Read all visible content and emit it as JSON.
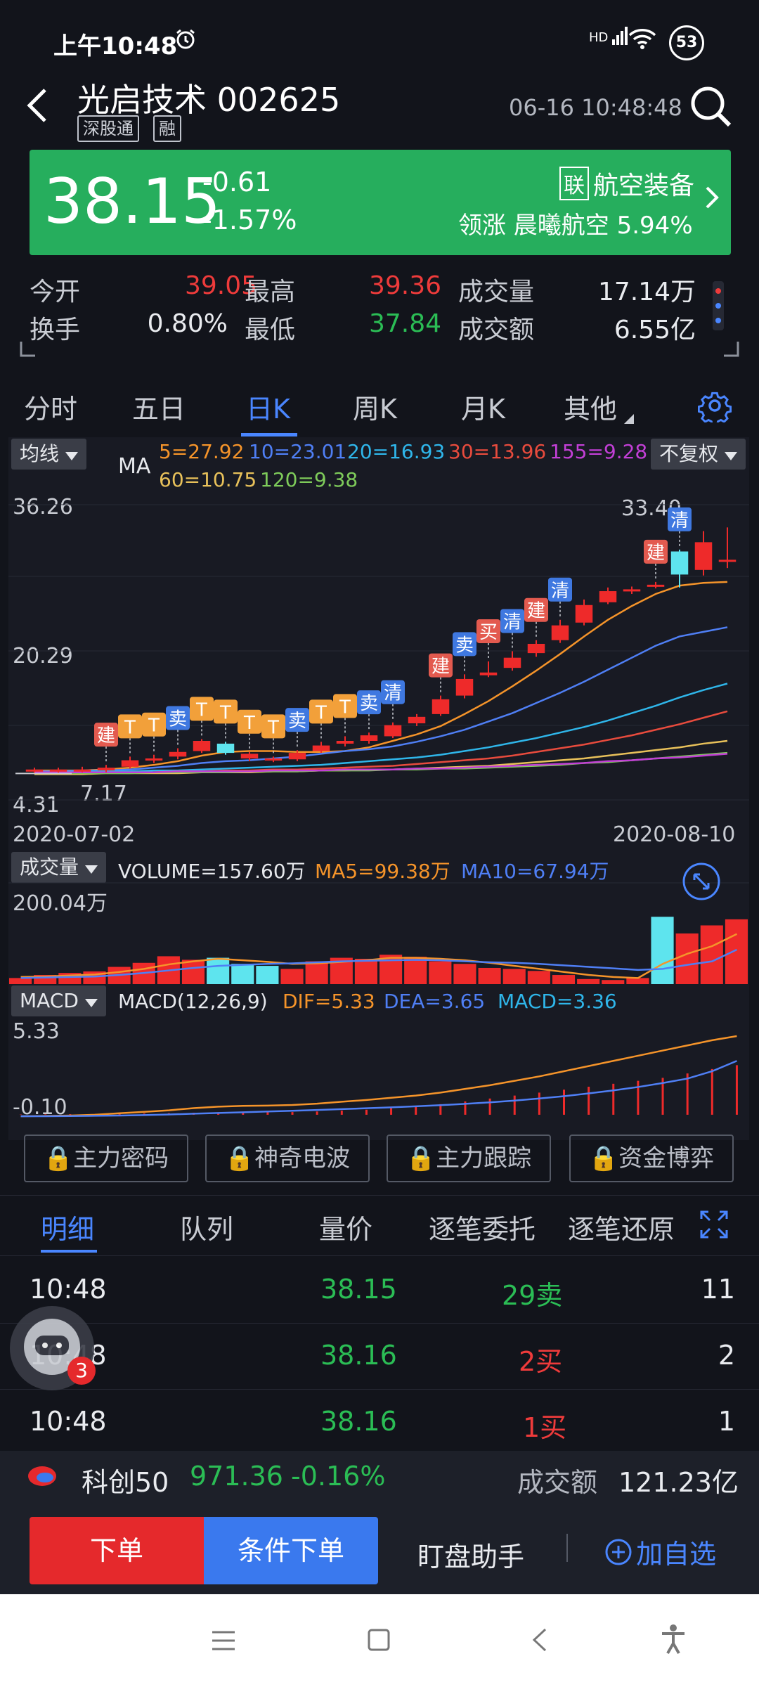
{
  "status": {
    "time": "上午10:48",
    "signal_label": "HD",
    "battery": "53"
  },
  "header": {
    "title": "光启技术 002625",
    "badges": [
      "深股通",
      "融"
    ],
    "datetime": "06-16 10:48:48"
  },
  "banner": {
    "price": "38.15",
    "change": "-0.61",
    "change_pct": "-1.57%",
    "lian_tag": "联",
    "sector": "航空装备",
    "lead": "领涨 晨曦航空 5.94%"
  },
  "quote": {
    "open_label": "今开",
    "open": "39.05",
    "high_label": "最高",
    "high": "39.36",
    "vol_label": "成交量",
    "vol": "17.14万",
    "turnover_label": "换手",
    "turnover": "0.80%",
    "low_label": "最低",
    "low": "37.84",
    "amount_label": "成交额",
    "amount": "6.55亿"
  },
  "period_tabs": [
    "分时",
    "五日",
    "日K",
    "周K",
    "月K",
    "其他"
  ],
  "ma_panel": {
    "selector": "均线",
    "ma_label": "MA",
    "ma5": "5=27.92",
    "ma10": "10=23.01",
    "ma20": "20=16.93",
    "ma30": "30=13.96",
    "ma155": "155=9.28",
    "ma60": "60=10.75",
    "ma120": "120=9.38",
    "adjust": "不复权",
    "y_top": "36.26",
    "y_mid": "20.29",
    "y_low": "4.31",
    "hi_marker": "33.40",
    "lo_marker": "7.17",
    "date_start": "2020-07-02",
    "date_end": "2020-08-10",
    "colors": {
      "ma5": "#f5942a",
      "ma10": "#4f7ff5",
      "ma20": "#2fb6ea",
      "ma30": "#e84b3d",
      "ma155": "#c23fd6",
      "ma60": "#e8c15a",
      "ma120": "#7ecb5a"
    }
  },
  "vol_panel": {
    "selector": "成交量",
    "volume": "VOLUME=157.60万",
    "ma5": "MA5=99.38万",
    "ma10": "MA10=67.94万",
    "y_top": "200.04万"
  },
  "macd_panel": {
    "selector": "MACD",
    "params": "MACD(12,26,9)",
    "dif": "DIF=5.33",
    "dea": "DEA=3.65",
    "macd": "MACD=3.36",
    "y_top": "5.33",
    "y_low": "-0.10"
  },
  "locked": [
    "主力密码",
    "神奇电波",
    "主力跟踪",
    "资金博弈"
  ],
  "detail_tabs": [
    "明细",
    "队列",
    "量价",
    "逐笔委托",
    "逐笔还原"
  ],
  "trades": [
    {
      "time": "10:48",
      "price": "38.15",
      "side": "29卖",
      "count": "11",
      "side_color": "#2bbd55"
    },
    {
      "time": "10:48",
      "price": "38.16",
      "side": "2买",
      "count": "2",
      "side_color": "#ee3b3b"
    },
    {
      "time": "10:48",
      "price": "38.16",
      "side": "1买",
      "count": "1",
      "side_color": "#ee3b3b"
    }
  ],
  "avatar_badge": "3",
  "index": {
    "name": "科创50",
    "value": "971.36",
    "pct": "-0.16%",
    "amount_label": "成交额",
    "amount": "121.23亿"
  },
  "actions": {
    "order": "下单",
    "cond_order": "条件下单",
    "assistant": "盯盘助手",
    "add_watch": "加自选"
  },
  "chart_data": {
    "type": "candlestick",
    "x_range": [
      "2020-07-02",
      "2020-08-10"
    ],
    "y_range": [
      4.31,
      36.26
    ],
    "high_marker": 33.4,
    "low_marker": 7.17,
    "candles": [
      {
        "o": 7.6,
        "c": 7.4,
        "h": 7.8,
        "l": 7.2
      },
      {
        "o": 7.4,
        "c": 7.6,
        "h": 7.8,
        "l": 7.2
      },
      {
        "o": 7.6,
        "c": 7.5,
        "h": 7.9,
        "l": 7.3
      },
      {
        "o": 7.5,
        "c": 7.8,
        "h": 8.1,
        "l": 7.3
      },
      {
        "o": 7.9,
        "c": 8.6,
        "h": 9.0,
        "l": 7.7
      },
      {
        "o": 8.7,
        "c": 8.8,
        "h": 9.2,
        "l": 8.3
      },
      {
        "o": 9.0,
        "c": 9.5,
        "h": 9.9,
        "l": 8.7
      },
      {
        "o": 9.6,
        "c": 10.7,
        "h": 10.9,
        "l": 9.4
      },
      {
        "o": 10.4,
        "c": 9.4,
        "h": 10.6,
        "l": 9.2
      },
      {
        "o": 9.3,
        "c": 8.8,
        "h": 9.5,
        "l": 8.5
      },
      {
        "o": 8.8,
        "c": 8.6,
        "h": 9.0,
        "l": 8.4
      },
      {
        "o": 8.7,
        "c": 9.4,
        "h": 9.7,
        "l": 8.5
      },
      {
        "o": 9.6,
        "c": 10.2,
        "h": 10.6,
        "l": 9.4
      },
      {
        "o": 10.4,
        "c": 10.7,
        "h": 11.2,
        "l": 10.1
      },
      {
        "o": 10.7,
        "c": 11.3,
        "h": 11.6,
        "l": 10.4
      },
      {
        "o": 11.2,
        "c": 12.4,
        "h": 12.7,
        "l": 11.0
      },
      {
        "o": 12.6,
        "c": 13.3,
        "h": 13.6,
        "l": 12.3
      },
      {
        "o": 13.6,
        "c": 15.2,
        "h": 15.6,
        "l": 13.4
      },
      {
        "o": 15.6,
        "c": 17.4,
        "h": 17.9,
        "l": 15.3
      },
      {
        "o": 17.8,
        "c": 18.1,
        "h": 19.3,
        "l": 17.6
      },
      {
        "o": 18.6,
        "c": 19.7,
        "h": 20.4,
        "l": 18.3
      },
      {
        "o": 20.2,
        "c": 21.2,
        "h": 21.6,
        "l": 19.8
      },
      {
        "o": 21.6,
        "c": 23.2,
        "h": 23.8,
        "l": 21.3
      },
      {
        "o": 23.5,
        "c": 25.4,
        "h": 26.0,
        "l": 23.2
      },
      {
        "o": 25.7,
        "c": 26.9,
        "h": 27.3,
        "l": 25.5
      },
      {
        "o": 27.0,
        "c": 27.1,
        "h": 27.4,
        "l": 26.6
      },
      {
        "o": 27.5,
        "c": 27.6,
        "h": 27.9,
        "l": 27.2
      },
      {
        "o": 28.7,
        "c": 31.2,
        "h": 31.4,
        "l": 27.3
      },
      {
        "o": 32.2,
        "c": 29.2,
        "h": 33.4,
        "l": 28.6
      },
      {
        "o": 30.1,
        "c": 30.3,
        "h": 33.8,
        "l": 29.4
      }
    ],
    "ma": {
      "MA5": [
        7.5,
        7.5,
        7.5,
        7.6,
        7.8,
        8.1,
        8.5,
        9.1,
        9.5,
        9.6,
        9.6,
        9.5,
        9.5,
        9.6,
        10.0,
        10.7,
        11.4,
        12.3,
        13.6,
        15.0,
        16.6,
        18.3,
        20.1,
        22.0,
        23.8,
        25.3,
        26.6,
        27.5,
        27.8,
        27.9
      ],
      "MA10": [
        7.4,
        7.4,
        7.5,
        7.5,
        7.6,
        7.8,
        8.0,
        8.3,
        8.5,
        8.6,
        8.8,
        9.0,
        9.3,
        9.6,
        9.8,
        10.1,
        10.6,
        11.2,
        11.9,
        12.8,
        13.7,
        14.8,
        15.9,
        17.1,
        18.4,
        19.7,
        21.0,
        22.0,
        22.5,
        23.0
      ],
      "MA20": [
        7.3,
        7.3,
        7.4,
        7.4,
        7.4,
        7.5,
        7.5,
        7.6,
        7.7,
        7.8,
        7.9,
        8.0,
        8.1,
        8.3,
        8.5,
        8.7,
        8.9,
        9.2,
        9.6,
        10.0,
        10.5,
        11.0,
        11.6,
        12.2,
        12.9,
        13.7,
        14.5,
        15.4,
        16.2,
        16.9
      ],
      "MA30": [
        7.2,
        7.2,
        7.3,
        7.3,
        7.3,
        7.3,
        7.4,
        7.4,
        7.5,
        7.5,
        7.6,
        7.6,
        7.7,
        7.8,
        7.9,
        8.0,
        8.2,
        8.4,
        8.6,
        8.8,
        9.1,
        9.5,
        9.9,
        10.3,
        10.8,
        11.3,
        11.9,
        12.5,
        13.2,
        13.9
      ],
      "MA60": [
        7.1,
        7.1,
        7.1,
        7.2,
        7.2,
        7.2,
        7.2,
        7.3,
        7.3,
        7.3,
        7.4,
        7.4,
        7.5,
        7.5,
        7.6,
        7.6,
        7.7,
        7.8,
        7.9,
        8.0,
        8.2,
        8.4,
        8.6,
        8.8,
        9.1,
        9.4,
        9.7,
        10.0,
        10.4,
        10.7
      ],
      "MA120": [
        7.2,
        7.2,
        7.2,
        7.2,
        7.2,
        7.3,
        7.3,
        7.3,
        7.3,
        7.4,
        7.4,
        7.4,
        7.5,
        7.5,
        7.5,
        7.6,
        7.6,
        7.7,
        7.7,
        7.8,
        7.9,
        8.0,
        8.1,
        8.3,
        8.4,
        8.6,
        8.8,
        9.0,
        9.2,
        9.4
      ],
      "MA155": [
        7.3,
        7.3,
        7.3,
        7.3,
        7.3,
        7.3,
        7.4,
        7.4,
        7.4,
        7.4,
        7.5,
        7.5,
        7.5,
        7.6,
        7.6,
        7.6,
        7.7,
        7.7,
        7.8,
        7.9,
        8.0,
        8.1,
        8.2,
        8.3,
        8.5,
        8.6,
        8.8,
        8.9,
        9.1,
        9.3
      ]
    },
    "signals": [
      {
        "i": 3,
        "t": "建"
      },
      {
        "i": 4,
        "t": "T"
      },
      {
        "i": 5,
        "t": "T"
      },
      {
        "i": 6,
        "t": "卖"
      },
      {
        "i": 7,
        "t": "T"
      },
      {
        "i": 8,
        "t": "T"
      },
      {
        "i": 9,
        "t": "T"
      },
      {
        "i": 10,
        "t": "T"
      },
      {
        "i": 11,
        "t": "卖"
      },
      {
        "i": 12,
        "t": "T"
      },
      {
        "i": 13,
        "t": "T"
      },
      {
        "i": 14,
        "t": "卖"
      },
      {
        "i": 15,
        "t": "清"
      },
      {
        "i": 17,
        "t": "建"
      },
      {
        "i": 18,
        "t": "卖"
      },
      {
        "i": 19,
        "t": "买"
      },
      {
        "i": 20,
        "t": "清"
      },
      {
        "i": 21,
        "t": "建"
      },
      {
        "i": 22,
        "t": "清"
      },
      {
        "i": 26,
        "t": "建"
      },
      {
        "i": 27,
        "t": "清"
      }
    ],
    "volume_wan": [
      12,
      18,
      22,
      25,
      34,
      42,
      55,
      48,
      52,
      40,
      36,
      30,
      45,
      52,
      50,
      58,
      54,
      45,
      40,
      32,
      30,
      26,
      18,
      10,
      8,
      12,
      133,
      100,
      116,
      128
    ],
    "volume_up": [
      true,
      true,
      true,
      true,
      true,
      true,
      true,
      true,
      false,
      false,
      false,
      true,
      true,
      true,
      true,
      true,
      true,
      true,
      true,
      true,
      true,
      true,
      true,
      true,
      true,
      true,
      false,
      true,
      true,
      true
    ],
    "vol_ma5": [
      14,
      15,
      17,
      19,
      24,
      30,
      39,
      45,
      50,
      47,
      44,
      40,
      41,
      44,
      47,
      52,
      52,
      50,
      47,
      42,
      36,
      30,
      24,
      18,
      14,
      12,
      40,
      60,
      75,
      99
    ],
    "vol_ma10": [
      12,
      13,
      14,
      15,
      18,
      22,
      27,
      32,
      36,
      38,
      40,
      41,
      43,
      45,
      46,
      47,
      48,
      47,
      45,
      43,
      42,
      40,
      37,
      34,
      31,
      28,
      30,
      38,
      45,
      68
    ],
    "macd_bar": [
      0.02,
      0.03,
      0.04,
      0.05,
      0.07,
      0.09,
      0.11,
      0.14,
      0.16,
      0.16,
      0.17,
      0.18,
      0.22,
      0.28,
      0.34,
      0.45,
      0.58,
      0.72,
      0.9,
      1.1,
      1.3,
      1.5,
      1.7,
      1.9,
      2.1,
      2.3,
      2.5,
      2.8,
      3.1,
      3.36
    ],
    "dif": [
      -0.1,
      -0.08,
      -0.05,
      0.0,
      0.1,
      0.2,
      0.3,
      0.45,
      0.55,
      0.6,
      0.62,
      0.66,
      0.75,
      0.88,
      1.0,
      1.15,
      1.3,
      1.5,
      1.75,
      2.0,
      2.3,
      2.6,
      2.95,
      3.3,
      3.65,
      4.0,
      4.35,
      4.7,
      5.05,
      5.33
    ],
    "dea": [
      -0.1,
      -0.1,
      -0.09,
      -0.07,
      -0.05,
      -0.02,
      0.02,
      0.07,
      0.12,
      0.17,
      0.22,
      0.27,
      0.32,
      0.38,
      0.44,
      0.5,
      0.57,
      0.65,
      0.74,
      0.84,
      0.96,
      1.1,
      1.26,
      1.45,
      1.65,
      1.88,
      2.15,
      2.45,
      2.95,
      3.65
    ]
  }
}
